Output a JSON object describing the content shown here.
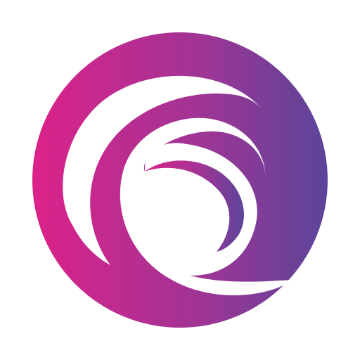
{
  "logo": {
    "icon": "swirl-wave-logo-icon",
    "colors": {
      "gradient_start": "#dc2289",
      "gradient_mid": "#a23495",
      "gradient_end": "#5b4599",
      "background": "#ffffff"
    }
  }
}
